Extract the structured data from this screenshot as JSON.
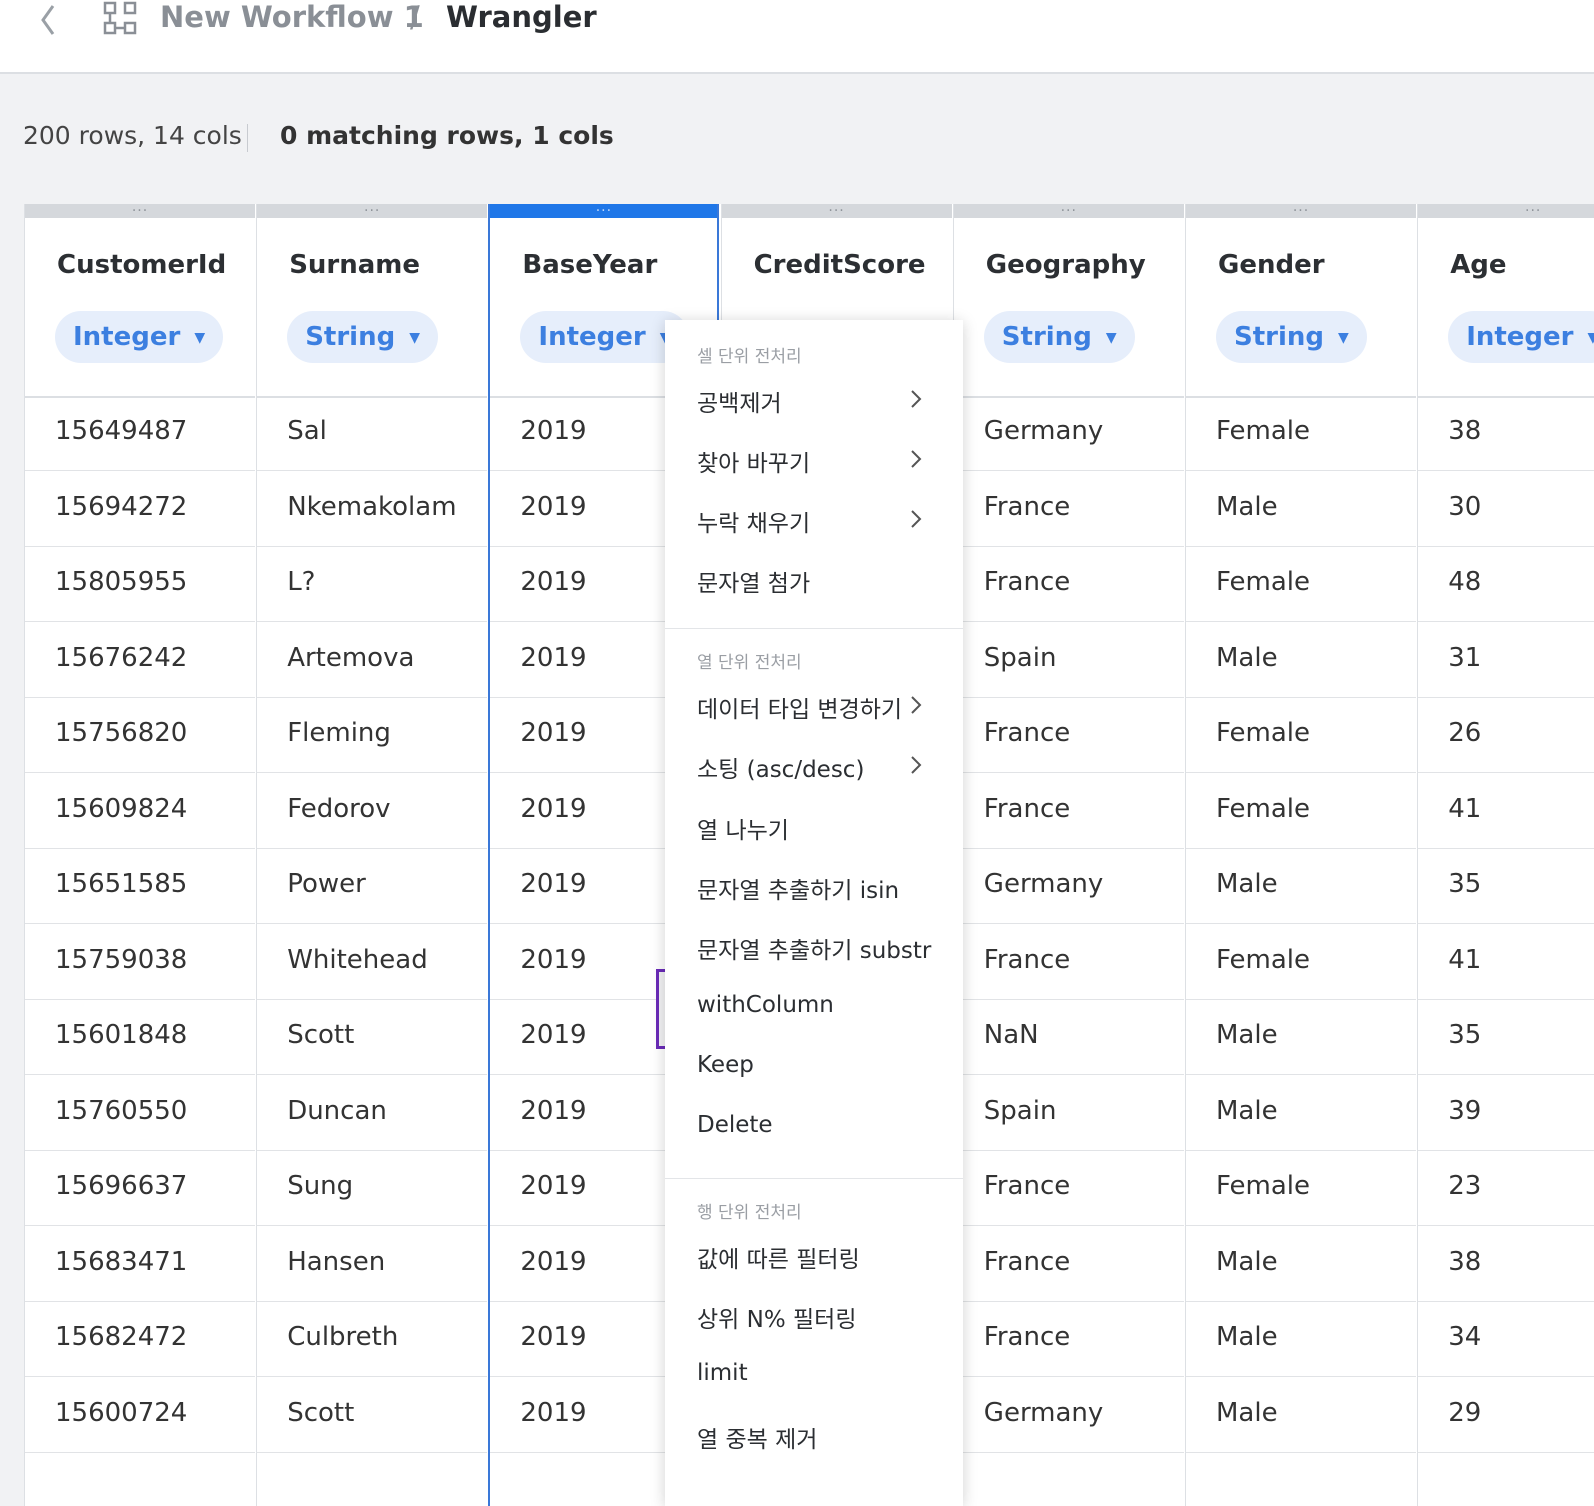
{
  "breadcrumb": {
    "workflow": "New Workflow 1",
    "separator": "/",
    "current": "Wrangler"
  },
  "stats": {
    "total": "200 rows, 14 cols",
    "matching": "0 matching rows, 1 cols"
  },
  "columns": [
    {
      "name": "CustomerId",
      "type": "Integer",
      "selected": false
    },
    {
      "name": "Surname",
      "type": "String",
      "selected": false
    },
    {
      "name": "BaseYear",
      "type": "Integer",
      "selected": true
    },
    {
      "name": "CreditScore",
      "type": "",
      "selected": false
    },
    {
      "name": "Geography",
      "type": "String",
      "selected": false
    },
    {
      "name": "Gender",
      "type": "String",
      "selected": false
    },
    {
      "name": "Age",
      "type": "Integer",
      "selected": false
    }
  ],
  "handle_glyph": "...",
  "caret_glyph": "▼",
  "rows": [
    [
      "15649487",
      "Sal",
      "2019",
      "",
      "Germany",
      "Female",
      "38"
    ],
    [
      "15694272",
      "Nkemakolam",
      "2019",
      "",
      "France",
      "Male",
      "30"
    ],
    [
      "15805955",
      "L?",
      "2019",
      "",
      "France",
      "Female",
      "48"
    ],
    [
      "15676242",
      "Artemova",
      "2019",
      "",
      "Spain",
      "Male",
      "31"
    ],
    [
      "15756820",
      "Fleming",
      "2019",
      "",
      "France",
      "Female",
      "26"
    ],
    [
      "15609824",
      "Fedorov",
      "2019",
      "",
      "France",
      "Female",
      "41"
    ],
    [
      "15651585",
      "Power",
      "2019",
      "",
      "Germany",
      "Male",
      "35"
    ],
    [
      "15759038",
      "Whitehead",
      "2019",
      "",
      "France",
      "Female",
      "41"
    ],
    [
      "15601848",
      "Scott",
      "2019",
      "",
      "NaN",
      "Male",
      "35"
    ],
    [
      "15760550",
      "Duncan",
      "2019",
      "",
      "Spain",
      "Male",
      "39"
    ],
    [
      "15696637",
      "Sung",
      "2019",
      "",
      "France",
      "Female",
      "23"
    ],
    [
      "15683471",
      "Hansen",
      "2019",
      "",
      "France",
      "Male",
      "38"
    ],
    [
      "15682472",
      "Culbreth",
      "2019",
      "",
      "France",
      "Male",
      "34"
    ],
    [
      "15600724",
      "Scott",
      "2019",
      "",
      "Germany",
      "Male",
      "29"
    ]
  ],
  "context_menu": {
    "sections": [
      {
        "title": "셀 단위 전처리",
        "items": [
          {
            "label": "공백제거",
            "submenu": true,
            "highlighted": false
          },
          {
            "label": "찾아 바꾸기",
            "submenu": true,
            "highlighted": false
          },
          {
            "label": "누락 채우기",
            "submenu": true,
            "highlighted": false
          },
          {
            "label": "문자열 첨가",
            "submenu": false,
            "highlighted": false
          }
        ]
      },
      {
        "title": "열 단위 전처리",
        "items": [
          {
            "label": "데이터 타입 변경하기",
            "submenu": true,
            "highlighted": false
          },
          {
            "label": "소팅 (asc/desc)",
            "submenu": true,
            "highlighted": false
          },
          {
            "label": "열 나누기",
            "submenu": false,
            "highlighted": false
          },
          {
            "label": "문자열 추출하기 isin",
            "submenu": false,
            "highlighted": false
          },
          {
            "label": "문자열 추출하기 substr",
            "submenu": false,
            "highlighted": false
          },
          {
            "label": "withColumn",
            "submenu": false,
            "highlighted": true
          },
          {
            "label": "Keep",
            "submenu": false,
            "highlighted": false
          },
          {
            "label": "Delete",
            "submenu": false,
            "highlighted": false
          }
        ]
      },
      {
        "title": "행 단위 전처리",
        "items": [
          {
            "label": "값에 따른 필터링",
            "submenu": false,
            "highlighted": false
          },
          {
            "label": "상위 N% 필터링",
            "submenu": false,
            "highlighted": false
          },
          {
            "label": "limit",
            "submenu": false,
            "highlighted": false
          },
          {
            "label": "열 중복 제거",
            "submenu": false,
            "highlighted": false
          }
        ]
      }
    ]
  },
  "colors": {
    "accent": "#1f77e8",
    "highlight_border": "#6a2bb8",
    "type_pill_bg": "#e6eefb",
    "type_pill_text": "#3c7fe0"
  }
}
